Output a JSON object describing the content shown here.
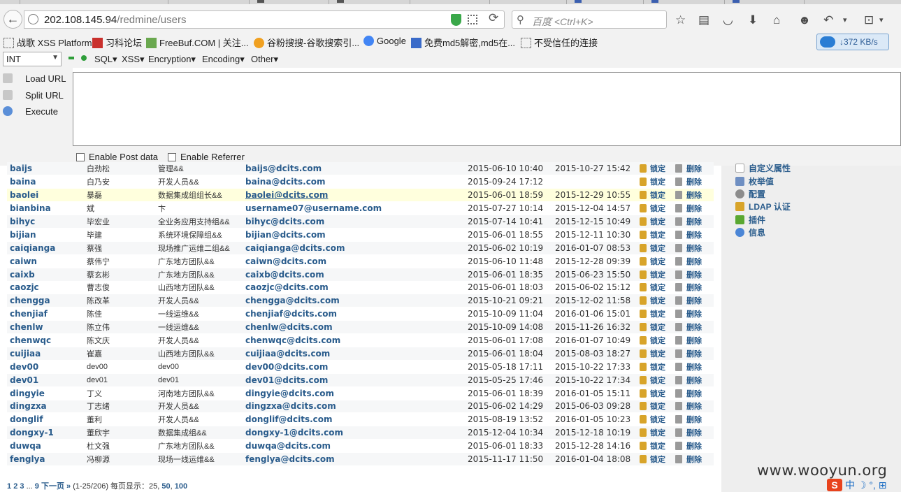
{
  "browser": {
    "url_host": "202.108.145.94",
    "url_path": "/redmine/users",
    "search_placeholder": "百度 <Ctrl+K>",
    "back_glyph": "←",
    "reload_glyph": "⟳"
  },
  "bookmarks": [
    {
      "label": "战歌 XSS Platform",
      "icon": "page-icon"
    },
    {
      "label": "习科论坛",
      "icon": "slc-icon"
    },
    {
      "label": "FreeBuf.COM | 关注...",
      "icon": "freebuf-icon"
    },
    {
      "label": "谷粉搜搜-谷歌搜索引...",
      "icon": "g-icon"
    },
    {
      "label": "Google",
      "icon": "google-icon"
    },
    {
      "label": "免费md5解密,md5在...",
      "icon": "md5-icon"
    },
    {
      "label": "不受信任的连接",
      "icon": "page-icon"
    }
  ],
  "speed": "372 KB/s",
  "hackbar": {
    "select_value": "INT",
    "menus": [
      "SQL▾",
      "XSS▾",
      "Encryption▾",
      "Encoding▾",
      "Other▾"
    ],
    "actions": [
      "Load URL",
      "Split URL",
      "Execute"
    ],
    "checkboxes": [
      "Enable Post data",
      "Enable Referrer"
    ]
  },
  "sidebar": [
    {
      "label": "自定义属性",
      "icon": "custom-fields-icon"
    },
    {
      "label": "枚举值",
      "icon": "list-icon"
    },
    {
      "label": "配置",
      "icon": "gear-icon"
    },
    {
      "label": "LDAP 认证",
      "icon": "ldap-icon"
    },
    {
      "label": "插件",
      "icon": "plugin-icon"
    },
    {
      "label": "信息",
      "icon": "info-icon"
    }
  ],
  "action_labels": {
    "lock": "锁定",
    "delete": "删除"
  },
  "users": [
    {
      "login": "baijs",
      "name": "白劲松",
      "dept": "管理&&",
      "email": "baijs@dcits.com",
      "created": "2015-06-10 10:40",
      "last": "2015-10-27 15:42"
    },
    {
      "login": "baina",
      "name": "白乃安",
      "dept": "开发人员&&",
      "email": "baina@dcits.com",
      "created": "2015-09-24 17:12",
      "last": ""
    },
    {
      "login": "baolei",
      "name": "暴磊",
      "dept": "数据集成组组长&&",
      "email": "baolei@dcits.com",
      "created": "2015-06-01 18:59",
      "last": "2015-12-29 10:55"
    },
    {
      "login": "bianbina",
      "name": "斌",
      "dept": "卞",
      "email": "username07@username.com",
      "created": "2015-07-27 10:14",
      "last": "2015-12-04 14:57"
    },
    {
      "login": "bihyc",
      "name": "毕宏业",
      "dept": "全业务应用支持组&&",
      "email": "bihyc@dcits.com",
      "created": "2015-07-14 10:41",
      "last": "2015-12-15 10:49"
    },
    {
      "login": "bijian",
      "name": "毕建",
      "dept": "系统环境保障组&&",
      "email": "bijian@dcits.com",
      "created": "2015-06-01 18:55",
      "last": "2015-12-11 10:30"
    },
    {
      "login": "caiqianga",
      "name": "蔡强",
      "dept": "现场推广运维二组&&",
      "email": "caiqianga@dcits.com",
      "created": "2015-06-02 10:19",
      "last": "2016-01-07 08:53"
    },
    {
      "login": "caiwn",
      "name": "蔡伟宁",
      "dept": "广东地方团队&&",
      "email": "caiwn@dcits.com",
      "created": "2015-06-10 11:48",
      "last": "2015-12-28 09:39"
    },
    {
      "login": "caixb",
      "name": "蔡玄彬",
      "dept": "广东地方团队&&",
      "email": "caixb@dcits.com",
      "created": "2015-06-01 18:35",
      "last": "2015-06-23 15:50"
    },
    {
      "login": "caozjc",
      "name": "曹志俊",
      "dept": "山西地方团队&&",
      "email": "caozjc@dcits.com",
      "created": "2015-06-01 18:03",
      "last": "2015-06-02 15:12"
    },
    {
      "login": "chengga",
      "name": "陈改革",
      "dept": "开发人员&&",
      "email": "chengga@dcits.com",
      "created": "2015-10-21 09:21",
      "last": "2015-12-02 11:58"
    },
    {
      "login": "chenjiaf",
      "name": "陈佳",
      "dept": "一线运维&&",
      "email": "chenjiaf@dcits.com",
      "created": "2015-10-09 11:04",
      "last": "2016-01-06 15:01"
    },
    {
      "login": "chenlw",
      "name": "陈立伟",
      "dept": "一线运维&&",
      "email": "chenlw@dcits.com",
      "created": "2015-10-09 14:08",
      "last": "2015-11-26 16:32"
    },
    {
      "login": "chenwqc",
      "name": "陈文庆",
      "dept": "开发人员&&",
      "email": "chenwqc@dcits.com",
      "created": "2015-06-01 17:08",
      "last": "2016-01-07 10:49"
    },
    {
      "login": "cuijiaa",
      "name": "崔嘉",
      "dept": "山西地方团队&&",
      "email": "cuijiaa@dcits.com",
      "created": "2015-06-01 18:04",
      "last": "2015-08-03 18:27"
    },
    {
      "login": "dev00",
      "name": "dev00",
      "dept": "dev00",
      "email": "dev00@dcits.com",
      "created": "2015-05-18 17:11",
      "last": "2015-10-22 17:33"
    },
    {
      "login": "dev01",
      "name": "dev01",
      "dept": "dev01",
      "email": "dev01@dcits.com",
      "created": "2015-05-25 17:46",
      "last": "2015-10-22 17:34"
    },
    {
      "login": "dingyie",
      "name": "丁义",
      "dept": "河南地方团队&&",
      "email": "dingyie@dcits.com",
      "created": "2015-06-01 18:39",
      "last": "2016-01-05 15:11"
    },
    {
      "login": "dingzxa",
      "name": "丁志绪",
      "dept": "开发人员&&",
      "email": "dingzxa@dcits.com",
      "created": "2015-06-02 14:29",
      "last": "2015-06-03 09:28"
    },
    {
      "login": "donglif",
      "name": "董利",
      "dept": "开发人员&&",
      "email": "donglif@dcits.com",
      "created": "2015-08-19 13:52",
      "last": "2016-01-05 10:23"
    },
    {
      "login": "dongxy-1",
      "name": "董欣宇",
      "dept": "数据集成组&&",
      "email": "dongxy-1@dcits.com",
      "created": "2015-12-04 10:34",
      "last": "2015-12-18 10:19"
    },
    {
      "login": "duwqa",
      "name": "杜文强",
      "dept": "广东地方团队&&",
      "email": "duwqa@dcits.com",
      "created": "2015-06-01 18:33",
      "last": "2015-12-28 14:16"
    },
    {
      "login": "fenglya",
      "name": "冯柳源",
      "dept": "现场一线运维&&",
      "email": "fenglya@dcits.com",
      "created": "2015-11-17 11:50",
      "last": "2016-01-04 18:08"
    }
  ],
  "pager": {
    "pages": [
      "1",
      "2",
      "3",
      "...",
      "9"
    ],
    "next": "下一页 »",
    "summary": "(1-25/206) 每页显示：25,",
    "per_page_options": [
      "50",
      "100"
    ]
  },
  "watermark": "www.wooyun.org",
  "tray": "中 ☽ °, ⊞"
}
